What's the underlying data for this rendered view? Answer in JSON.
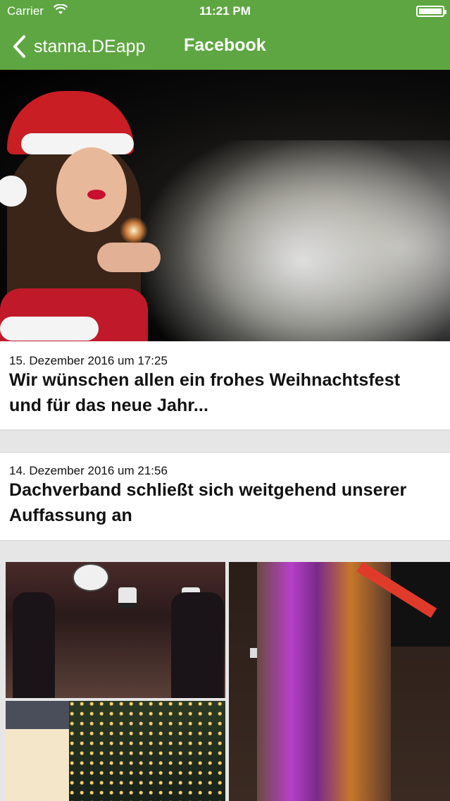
{
  "status_bar": {
    "carrier": "Carrier",
    "time": "11:21 PM"
  },
  "nav": {
    "back_label": "stanna.DEapp",
    "title": "Facebook"
  },
  "posts": [
    {
      "date": "15. Dezember 2016 um 17:25",
      "title": "Wir wünschen allen ein frohes Weihnachtsfest und für das neue Jahr..."
    },
    {
      "date": "14. Dezember 2016 um 21:56",
      "title": "Dachverband schließt sich weitgehend unserer Auffassung an"
    }
  ],
  "colors": {
    "nav_bar": "#5ea641",
    "background": "#e6e6e6",
    "card": "#ffffff"
  },
  "icons": [
    "wifi-icon",
    "battery-icon",
    "back-chevron-icon"
  ]
}
